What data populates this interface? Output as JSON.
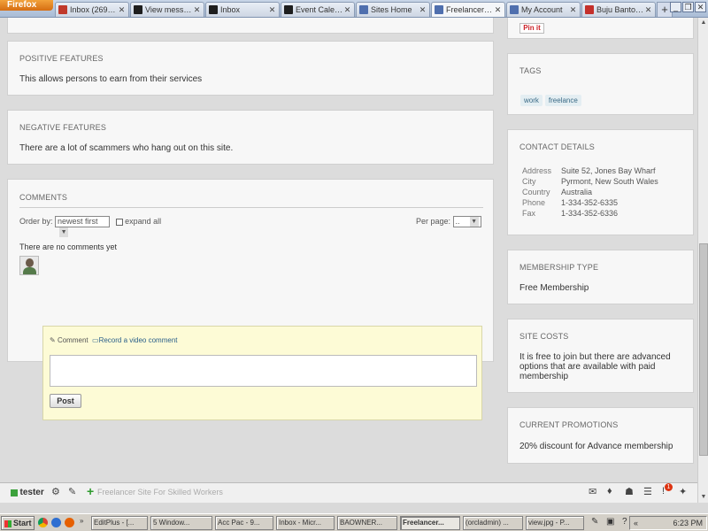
{
  "browser": {
    "menu_label": "Firefox",
    "tabs": [
      {
        "label": "Inbox (269) - ...",
        "color": "#c0392b"
      },
      {
        "label": "View message",
        "color": "#1e1e1e"
      },
      {
        "label": "Inbox",
        "color": "#1e1e1e"
      },
      {
        "label": "Event Calend...",
        "color": "#1e1e1e"
      },
      {
        "label": "Sites Home",
        "color": "#4f6fae"
      },
      {
        "label": "Freelancer Sit...",
        "color": "#4f6fae",
        "active": true
      },
      {
        "label": "My Account",
        "color": "#4f6fae"
      },
      {
        "label": "Buju Banton - ...",
        "color": "#c4302b"
      }
    ],
    "new_tab": "+"
  },
  "main": {
    "top_button": "Pin it",
    "positive": {
      "heading": "POSITIVE FEATURES",
      "text": "This allows persons to earn from their services"
    },
    "negative": {
      "heading": "NEGATIVE FEATURES",
      "text": "There are a lot of scammers who hang out on this site."
    },
    "comments": {
      "heading": "COMMENTS",
      "order_label": "Order by:",
      "order_value": "newest first",
      "expand_label": "expand all",
      "per_page_label": "Per page:",
      "per_page_value": "..",
      "empty_text": "There are no comments yet",
      "comment_tab": "Comment",
      "video_tab": "Record a video comment",
      "post_label": "Post"
    }
  },
  "sidebar": {
    "tags": {
      "heading": "TAGS",
      "items": [
        "work",
        "freelance"
      ]
    },
    "contact": {
      "heading": "CONTACT DETAILS",
      "rows": [
        {
          "k": "Address",
          "v": "Suite 52, Jones Bay Wharf"
        },
        {
          "k": "City",
          "v": "Pyrmont, New South Wales"
        },
        {
          "k": "Country",
          "v": "Australia"
        },
        {
          "k": "Phone",
          "v": "1-334-352-6335"
        },
        {
          "k": "Fax",
          "v": "1-334-352-6336"
        }
      ]
    },
    "membership": {
      "heading": "MEMBERSHIP TYPE",
      "text": "Free Membership"
    },
    "costs": {
      "heading": "SITE COSTS",
      "text": "It is free to join but there are advanced options that are available with paid membership"
    },
    "promotions": {
      "heading": "CURRENT PROMOTIONS",
      "text": "20% discount for Advance membership"
    }
  },
  "toolbar": {
    "user": "tester",
    "site_title": "Freelancer Site For Skilled Workers",
    "badge_count": "1"
  },
  "taskbar": {
    "start_label": "Start",
    "items": [
      "EditPlus - [...",
      "5 Window...",
      "Acc Pac - 9...",
      "Inbox - Micr...",
      "BAOWNER...",
      "Freelancer...",
      "(orcladmin) ...",
      "view.jpg - P..."
    ],
    "clock": "6:23 PM"
  }
}
